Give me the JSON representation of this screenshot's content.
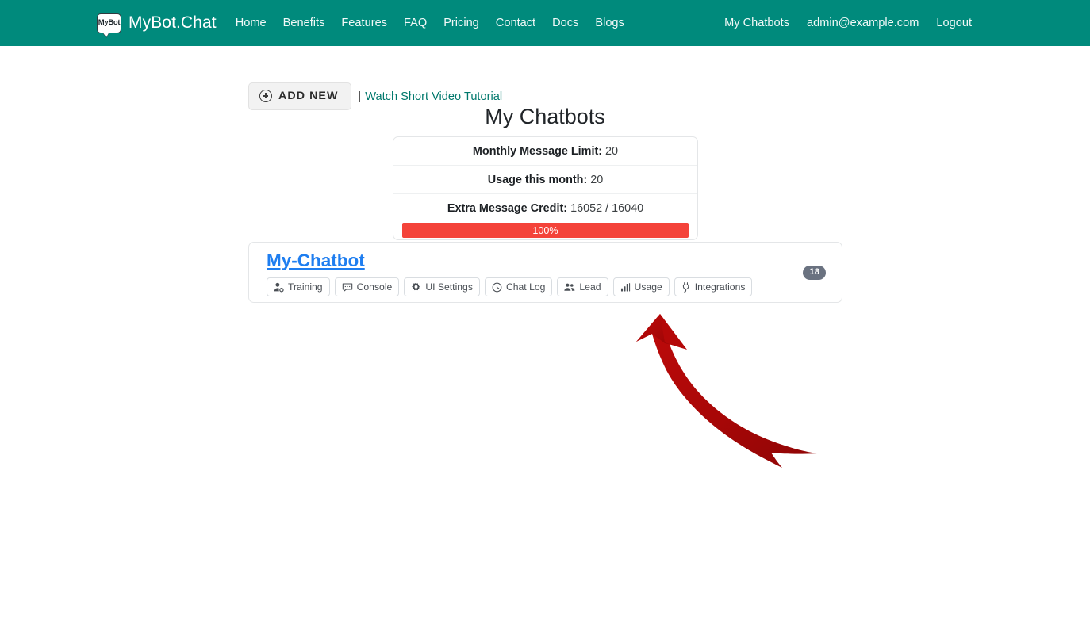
{
  "navbar": {
    "logo_text": "MyBot",
    "brand": "MyBot.Chat",
    "links": [
      {
        "label": "Home",
        "name": "nav-link-home"
      },
      {
        "label": "Benefits",
        "name": "nav-link-benefits"
      },
      {
        "label": "Features",
        "name": "nav-link-features"
      },
      {
        "label": "FAQ",
        "name": "nav-link-faq"
      },
      {
        "label": "Pricing",
        "name": "nav-link-pricing"
      },
      {
        "label": "Contact",
        "name": "nav-link-contact"
      },
      {
        "label": "Docs",
        "name": "nav-link-docs"
      },
      {
        "label": "Blogs",
        "name": "nav-link-blogs"
      }
    ],
    "right_links": [
      {
        "label": "My Chatbots",
        "name": "nav-link-my-chatbots"
      },
      {
        "label": "admin@example.com",
        "name": "nav-link-account-email"
      },
      {
        "label": "Logout",
        "name": "nav-link-logout"
      }
    ]
  },
  "toolbar": {
    "add_new_label": "ADD NEW",
    "separator": "|",
    "tutorial_label": "Watch Short Video Tutorial"
  },
  "page": {
    "title": "My Chatbots"
  },
  "stats": {
    "rows": [
      {
        "label": "Monthly Message Limit:",
        "value": "20"
      },
      {
        "label": "Usage this month:",
        "value": "20"
      },
      {
        "label": "Extra Message Credit:",
        "value": "16052 / 16040"
      }
    ],
    "progress": {
      "text": "100%",
      "percent": 100,
      "color": "#f4433a"
    }
  },
  "chatbot": {
    "name": "My-Chatbot",
    "badge": "18",
    "actions": [
      {
        "label": "Training",
        "icon": "user-gear-icon"
      },
      {
        "label": "Console",
        "icon": "comment-dots-icon"
      },
      {
        "label": "UI Settings",
        "icon": "gear-icon"
      },
      {
        "label": "Chat Log",
        "icon": "clock-icon"
      },
      {
        "label": "Lead",
        "icon": "users-icon"
      },
      {
        "label": "Usage",
        "icon": "chart-bars-icon"
      },
      {
        "label": "Integrations",
        "icon": "plug-icon"
      }
    ]
  },
  "annotation": {
    "arrow_color": "#ad0909",
    "arrow_name": "red-curved-arrow-pointing-to-integrations"
  },
  "colors": {
    "navbar": "#008a7c",
    "brand_link": "#1f7ef0",
    "tutorial_link": "#00786c",
    "progress": "#f4433a",
    "badge": "#6a7280"
  }
}
